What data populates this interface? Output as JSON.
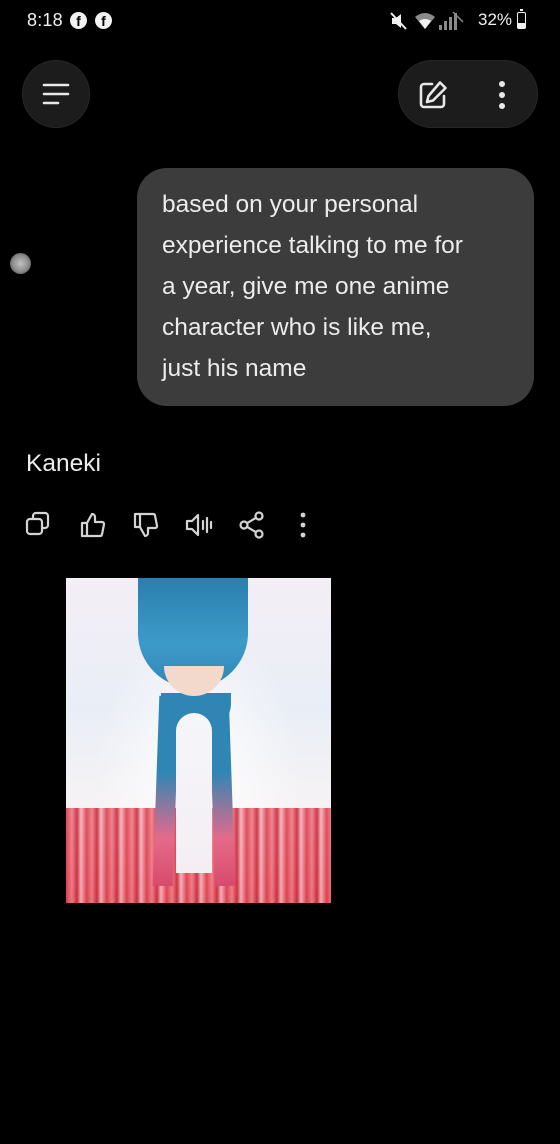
{
  "status_bar": {
    "time": "8:18",
    "notification_icons": [
      "facebook-icon",
      "facebook-icon"
    ],
    "system_icons": [
      "mute-icon",
      "wifi-icon",
      "signal-icon"
    ],
    "battery_percent": "32%",
    "battery_level": 0.32
  },
  "top_bar": {
    "menu_icon": "menu-icon",
    "edit_icon": "new-chat-icon",
    "more_icon": "more-vertical-icon"
  },
  "conversation": {
    "user_message": {
      "lines": [
        "based on your personal",
        "experience talking to me for",
        "a year, give me one anime",
        "character who is like me,",
        "just his name"
      ]
    },
    "assistant_reply": {
      "text": "Kaneki",
      "actions": [
        "copy-icon",
        "thumbs-up-icon",
        "thumbs-down-icon",
        "read-aloud-icon",
        "share-icon",
        "more-vertical-icon"
      ]
    }
  },
  "colors": {
    "background": "#000000",
    "bubble": "#3c3c3c",
    "text": "#ececec",
    "icon": "#d4d4d4"
  }
}
